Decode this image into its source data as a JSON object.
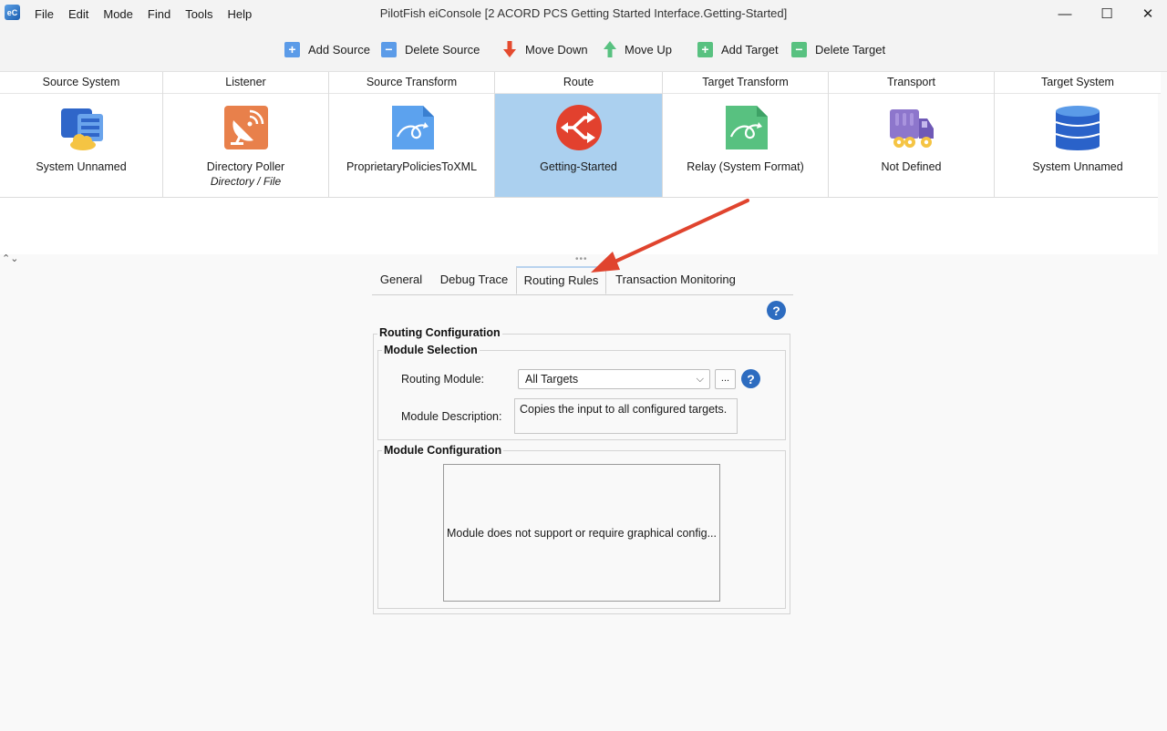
{
  "window": {
    "title": "PilotFish eiConsole [2 ACORD PCS Getting Started Interface.Getting-Started]",
    "minimize": "—",
    "maximize": "☐",
    "close": "✕"
  },
  "menu": [
    "File",
    "Edit",
    "Mode",
    "Find",
    "Tools",
    "Help"
  ],
  "toolbar": {
    "add_source": "Add Source",
    "delete_source": "Delete Source",
    "move_down": "Move Down",
    "move_up": "Move Up",
    "add_target": "Add Target",
    "delete_target": "Delete Target"
  },
  "pipeline": {
    "stages": [
      {
        "header": "Source System",
        "label": "System Unnamed",
        "sublabel": "",
        "icon": "source-system-icon"
      },
      {
        "header": "Listener",
        "label": "Directory Poller",
        "sublabel": "Directory / File",
        "icon": "satellite-dish-icon"
      },
      {
        "header": "Source Transform",
        "label": "ProprietaryPoliciesToXML",
        "sublabel": "",
        "icon": "transform-document-icon"
      },
      {
        "header": "Route",
        "label": "Getting-Started",
        "sublabel": "",
        "icon": "route-shuffle-icon",
        "selected": true
      },
      {
        "header": "Target Transform",
        "label": "Relay (System Format)",
        "sublabel": "",
        "icon": "relay-document-icon"
      },
      {
        "header": "Transport",
        "label": "Not Defined",
        "sublabel": "",
        "icon": "truck-icon"
      },
      {
        "header": "Target System",
        "label": "System Unnamed",
        "sublabel": "",
        "icon": "database-icon"
      }
    ]
  },
  "tabs": [
    "General",
    "Debug Trace",
    "Routing Rules",
    "Transaction Monitoring"
  ],
  "active_tab": "Routing Rules",
  "routing_config": {
    "title": "Routing Configuration",
    "module_selection": {
      "title": "Module Selection",
      "routing_module_label": "Routing Module:",
      "routing_module_value": "All Targets",
      "browse_label": "...",
      "module_description_label": "Module Description:",
      "module_description_value": "Copies the input to all configured targets."
    },
    "module_configuration": {
      "title": "Module Configuration",
      "message": "Module does not support or require graphical config..."
    }
  },
  "colors": {
    "selected_stage": "#abd0ef",
    "help_icon": "#2d6cc0",
    "annotation_arrow": "#e0442e"
  }
}
